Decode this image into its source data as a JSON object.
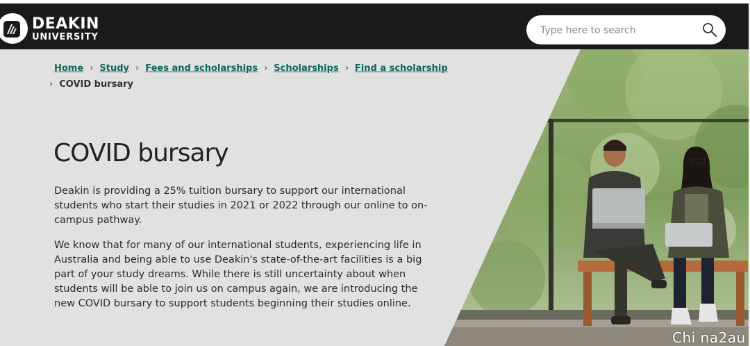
{
  "header": {
    "logo_line1": "DEAKIN",
    "logo_line2": "UNIVERSITY",
    "search_placeholder": "Type here to search",
    "search_icon": "search-icon"
  },
  "breadcrumb": {
    "items": [
      {
        "label": "Home"
      },
      {
        "label": "Study"
      },
      {
        "label": "Fees and scholarships"
      },
      {
        "label": "Scholarships"
      },
      {
        "label": "Find a scholarship"
      }
    ],
    "current": "COVID bursary",
    "separator": "›"
  },
  "main": {
    "title": "COVID bursary",
    "paragraph1": "Deakin is providing a 25% tuition bursary to support our international students who start their studies in 2021 or 2022 through our online to on-campus pathway.",
    "paragraph2": "We know that for many of our international students, experiencing life in Australia and being able to use Deakin's state-of-the-art facilities is a big part of your study dreams. While there is still uncertainty about when students will be able to join us on campus again, we are introducing the new COVID bursary to support students beginning their studies online."
  },
  "watermark": "Chi na2au",
  "colors": {
    "header_bg": "#1a1a1a",
    "page_bg": "#e1e1e1",
    "link": "#10655b"
  }
}
